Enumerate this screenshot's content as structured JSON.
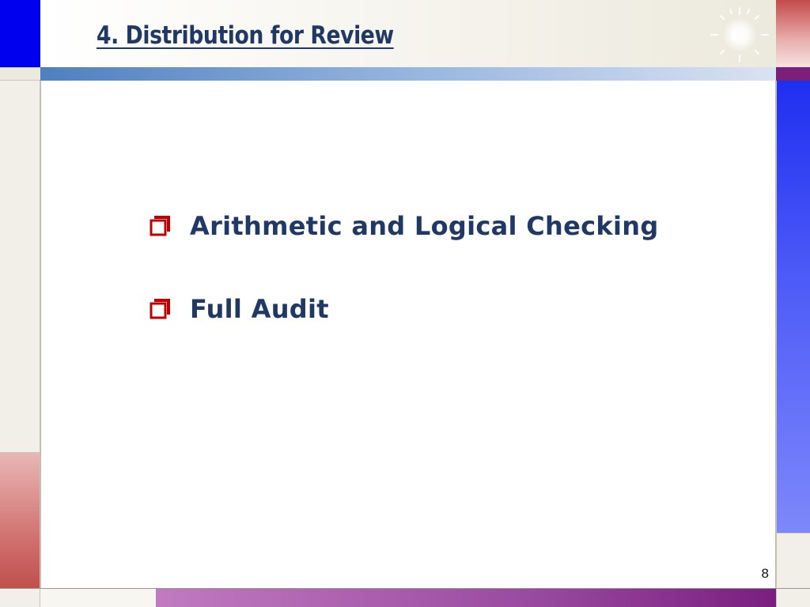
{
  "slide": {
    "title": "4. Distribution for Review",
    "bullets": [
      {
        "text": "Arithmetic and Logical Checking",
        "icon": "checkbox-bullet-icon"
      },
      {
        "text": "Full Audit",
        "icon": "checkbox-bullet-icon"
      }
    ],
    "page_number": "8"
  },
  "colors": {
    "title_text": "#1f3864",
    "bullet_text": "#1f3864",
    "bullet_icon": "#c00000",
    "accent_blue": "#0000ee",
    "accent_red": "#c0504d",
    "accent_purple": "#7a1f80"
  }
}
